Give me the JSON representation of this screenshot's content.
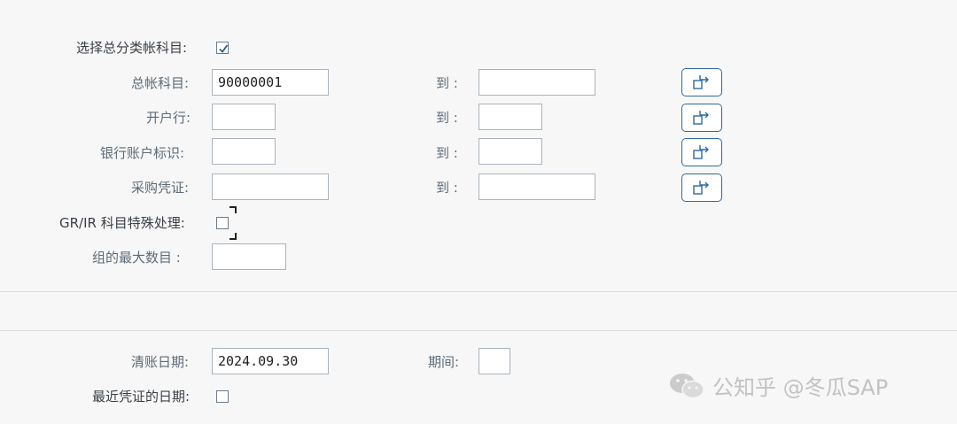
{
  "form": {
    "select_gl_label": "选择总分类帐科目:",
    "select_gl_checked": true,
    "gl_account_label": "总帐科目:",
    "gl_account_from": "90000001",
    "gl_account_to": "",
    "house_bank_label": "开户行:",
    "house_bank_from": "",
    "house_bank_to": "",
    "bank_account_id_label": "银行账户标识:",
    "bank_account_id_from": "",
    "bank_account_id_to": "",
    "purchasing_doc_label": "采购凭证:",
    "purchasing_doc_from": "",
    "purchasing_doc_to": "",
    "to_label": "到 :",
    "grir_label": "GR/IR 科目特殊处理:",
    "grir_checked": false,
    "max_groups_label": "组的最大数目 :",
    "max_groups_value": ""
  },
  "clearing": {
    "clearing_date_label": "清账日期:",
    "clearing_date_value": "2024.09.30",
    "period_label": "期间:",
    "period_value": "",
    "last_doc_date_label": "最近凭证的日期:",
    "last_doc_date_checked": false
  },
  "watermark": {
    "text": "公知乎 @冬瓜SAP"
  },
  "colors": {
    "accent": "#2d6aa0",
    "label": "#5e6b78",
    "border": "#a9b3bd",
    "background": "#f7f7f7"
  },
  "icons": {
    "multiple_selection": "multiple-selection-icon",
    "checkbox_checked": "checkmark-icon",
    "watermark_logo": "wechat-icon"
  }
}
